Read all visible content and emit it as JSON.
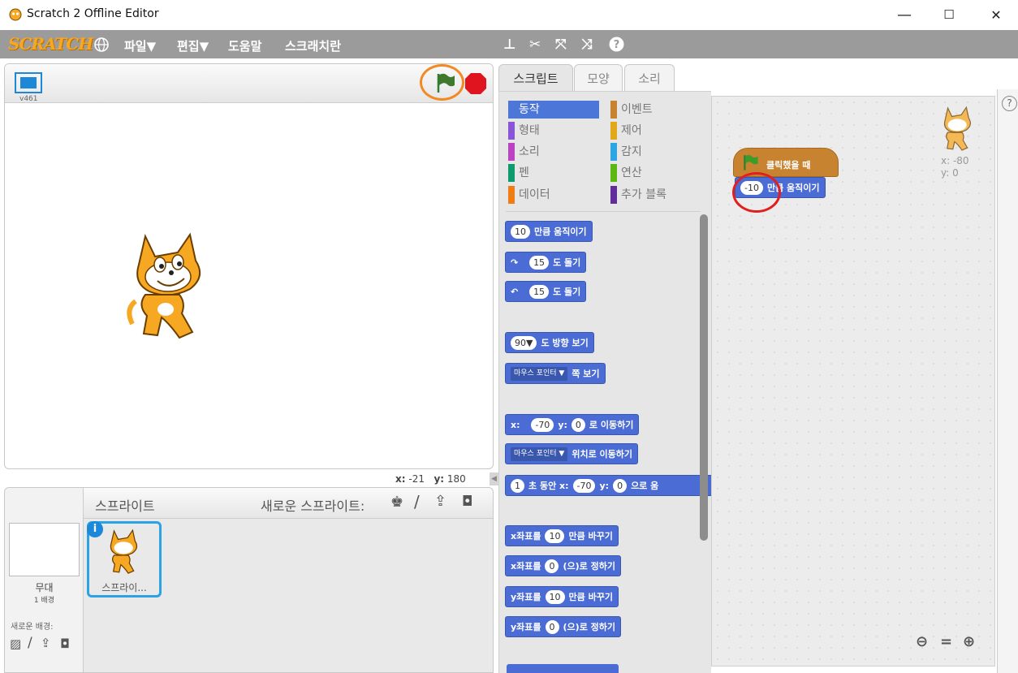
{
  "window": {
    "title": "Scratch 2 Offline Editor",
    "minimize": "—",
    "maximize": "☐",
    "close": "✕"
  },
  "menubar": {
    "logo": "SCRATCH",
    "items": [
      "파일▼",
      "편집▼",
      "도움말",
      "스크래치란"
    ],
    "tools": [
      "copy-stamp-icon",
      "cut-scissors-icon",
      "grow-icon",
      "shrink-icon",
      "help-icon"
    ]
  },
  "stage": {
    "version": "v461",
    "coords_x_label": "x:",
    "coords_x": "-21",
    "coords_y_label": "y:",
    "coords_y": "180"
  },
  "sprites": {
    "header_label": "스프라이트",
    "new_sprite_label": "새로운 스프라이트:",
    "stage_name": "무대",
    "stage_backdrops": "1 배경",
    "new_backdrop_label": "새로운 배경:",
    "sprite1_name": "스프라이..."
  },
  "tabs": [
    "스크립트",
    "모양",
    "소리"
  ],
  "categories": [
    {
      "label": "동작",
      "color": "#4c77d9"
    },
    {
      "label": "형태",
      "color": "#8a55d7"
    },
    {
      "label": "소리",
      "color": "#bb42c3"
    },
    {
      "label": "펜",
      "color": "#0e9a6c"
    },
    {
      "label": "데이터",
      "color": "#ee7d16"
    },
    {
      "label": "이벤트",
      "color": "#c88330"
    },
    {
      "label": "제어",
      "color": "#e1a91a"
    },
    {
      "label": "감지",
      "color": "#2ca5e2"
    },
    {
      "label": "연산",
      "color": "#5cb712"
    },
    {
      "label": "추가 블록",
      "color": "#632d99"
    }
  ],
  "blocks": {
    "move_num": "10",
    "move_text": "만큼 움직이기",
    "turn_cw_num": "15",
    "turn_cw_text": "도 돌기",
    "turn_ccw_num": "15",
    "turn_ccw_text": "도 돌기",
    "point_dir_num": "90▼",
    "point_dir_text": "도 방향 보기",
    "point_towards_dd": "마우스 포인터 ▼",
    "point_towards_text": "쪽 보기",
    "goto_xy_x_label": "x:",
    "goto_xy_x": "-70",
    "goto_xy_y_label": "y:",
    "goto_xy_y": "0",
    "goto_xy_text": "로 이동하기",
    "goto_dd": "마우스 포인터 ▼",
    "goto_text": "위치로 이동하기",
    "glide_num": "1",
    "glide_text1": "초 동안 x:",
    "glide_x": "-70",
    "glide_y_label": "y:",
    "glide_y": "0",
    "glide_text2": "으로 움",
    "change_x_label": "x좌표를",
    "change_x_num": "10",
    "change_x_text": "만큼 바꾸기",
    "set_x_label": "x좌표를",
    "set_x_num": "0",
    "set_x_text": "(으)로 정하기",
    "change_y_label": "y좌표를",
    "change_y_num": "10",
    "change_y_text": "만큼 바꾸기",
    "set_y_label": "y좌표를",
    "set_y_num": "0",
    "set_y_text": "(으)로 정하기"
  },
  "script": {
    "hat_text": "클릭했을 때",
    "move_num": "-10",
    "move_text": "만큼 움직이기",
    "sprite_x": "x: -80",
    "sprite_y": "y: 0"
  },
  "zoom": {
    "out": "🔍−",
    "reset": "=",
    "in": "🔍+"
  }
}
